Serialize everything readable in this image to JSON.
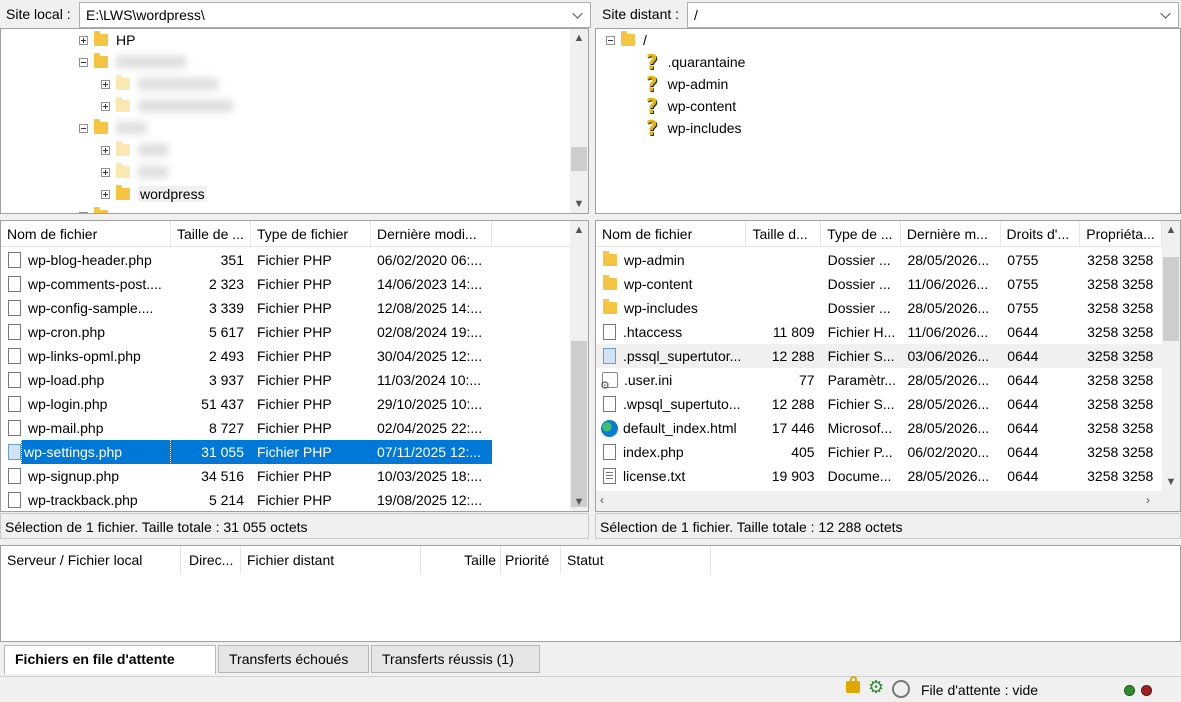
{
  "local_site": {
    "label": "Site local :",
    "path": "E:\\LWS\\wordpress\\"
  },
  "remote_site": {
    "label": "Site distant :",
    "path": "/"
  },
  "local_tree": {
    "items": [
      {
        "label": "HP"
      },
      {
        "label": ""
      },
      {
        "label": ""
      },
      {
        "label": ""
      },
      {
        "label": ""
      },
      {
        "label": ""
      },
      {
        "label": ""
      },
      {
        "label": "wordpress"
      },
      {
        "label": ""
      }
    ]
  },
  "remote_tree": {
    "root": "/",
    "items": [
      {
        "label": ".quarantaine"
      },
      {
        "label": "wp-admin"
      },
      {
        "label": "wp-content"
      },
      {
        "label": "wp-includes"
      }
    ]
  },
  "local_list": {
    "headers": [
      "Nom de fichier",
      "Taille de ...",
      "Type de fichier",
      "Dernière modi..."
    ],
    "rows": [
      {
        "name": "wp-blog-header.php",
        "size": "351",
        "type": "Fichier PHP",
        "date": "06/02/2020 06:..."
      },
      {
        "name": "wp-comments-post....",
        "size": "2 323",
        "type": "Fichier PHP",
        "date": "14/06/2023 14:..."
      },
      {
        "name": "wp-config-sample....",
        "size": "3 339",
        "type": "Fichier PHP",
        "date": "12/08/2025 14:..."
      },
      {
        "name": "wp-cron.php",
        "size": "5 617",
        "type": "Fichier PHP",
        "date": "02/08/2024 19:..."
      },
      {
        "name": "wp-links-opml.php",
        "size": "2 493",
        "type": "Fichier PHP",
        "date": "30/04/2025 12:..."
      },
      {
        "name": "wp-load.php",
        "size": "3 937",
        "type": "Fichier PHP",
        "date": "11/03/2024 10:..."
      },
      {
        "name": "wp-login.php",
        "size": "51 437",
        "type": "Fichier PHP",
        "date": "29/10/2025 10:..."
      },
      {
        "name": "wp-mail.php",
        "size": "8 727",
        "type": "Fichier PHP",
        "date": "02/04/2025 22:..."
      },
      {
        "name": "wp-settings.php",
        "size": "31 055",
        "type": "Fichier PHP",
        "date": "07/11/2025 12:..."
      },
      {
        "name": "wp-signup.php",
        "size": "34 516",
        "type": "Fichier PHP",
        "date": "10/03/2025 18:..."
      },
      {
        "name": "wp-trackback.php",
        "size": "5 214",
        "type": "Fichier PHP",
        "date": "19/08/2025 12:..."
      }
    ],
    "status": "Sélection de 1 fichier. Taille totale : 31 055 octets"
  },
  "remote_list": {
    "headers": [
      "Nom de fichier",
      "Taille d...",
      "Type de ...",
      "Dernière m...",
      "Droits d'...",
      "Propriéta..."
    ],
    "rows": [
      {
        "icon": "folder",
        "name": "wp-admin",
        "size": "",
        "type": "Dossier ...",
        "date": "28/05/2026...",
        "perm": "0755",
        "owner": "3258 3258"
      },
      {
        "icon": "folder",
        "name": "wp-content",
        "size": "",
        "type": "Dossier ...",
        "date": "11/06/2026...",
        "perm": "0755",
        "owner": "3258 3258"
      },
      {
        "icon": "folder",
        "name": "wp-includes",
        "size": "",
        "type": "Dossier ...",
        "date": "28/05/2026...",
        "perm": "0755",
        "owner": "3258 3258"
      },
      {
        "icon": "file",
        "name": ".htaccess",
        "size": "11 809",
        "type": "Fichier H...",
        "date": "11/06/2026...",
        "perm": "0644",
        "owner": "3258 3258"
      },
      {
        "icon": "file-blue",
        "name": ".pssql_supertutor...",
        "size": "12 288",
        "type": "Fichier S...",
        "date": "03/06/2026...",
        "perm": "0644",
        "owner": "3258 3258"
      },
      {
        "icon": "gear-file",
        "name": ".user.ini",
        "size": "77",
        "type": "Paramètr...",
        "date": "28/05/2026...",
        "perm": "0644",
        "owner": "3258 3258"
      },
      {
        "icon": "file",
        "name": ".wpsql_supertuto...",
        "size": "12 288",
        "type": "Fichier S...",
        "date": "28/05/2026...",
        "perm": "0644",
        "owner": "3258 3258"
      },
      {
        "icon": "edge",
        "name": "default_index.html",
        "size": "17 446",
        "type": "Microsof...",
        "date": "28/05/2026...",
        "perm": "0644",
        "owner": "3258 3258"
      },
      {
        "icon": "file",
        "name": "index.php",
        "size": "405",
        "type": "Fichier P...",
        "date": "06/02/2020...",
        "perm": "0644",
        "owner": "3258 3258"
      },
      {
        "icon": "file-txt",
        "name": "license.txt",
        "size": "19 903",
        "type": "Docume...",
        "date": "28/05/2026...",
        "perm": "0644",
        "owner": "3258 3258"
      }
    ],
    "status": "Sélection de 1 fichier. Taille totale : 12 288 octets"
  },
  "queue": {
    "headers": [
      "Serveur / Fichier local",
      "Direc...",
      "Fichier distant",
      "Taille",
      "Priorité",
      "Statut"
    ]
  },
  "tabs": [
    "Fichiers en file d'attente",
    "Transferts échoués",
    "Transferts réussis (1)"
  ],
  "statusbar": {
    "queue_text": "File d'attente : vide"
  },
  "colors": {
    "selection": "#0078d7",
    "folder": "#f5c542"
  }
}
